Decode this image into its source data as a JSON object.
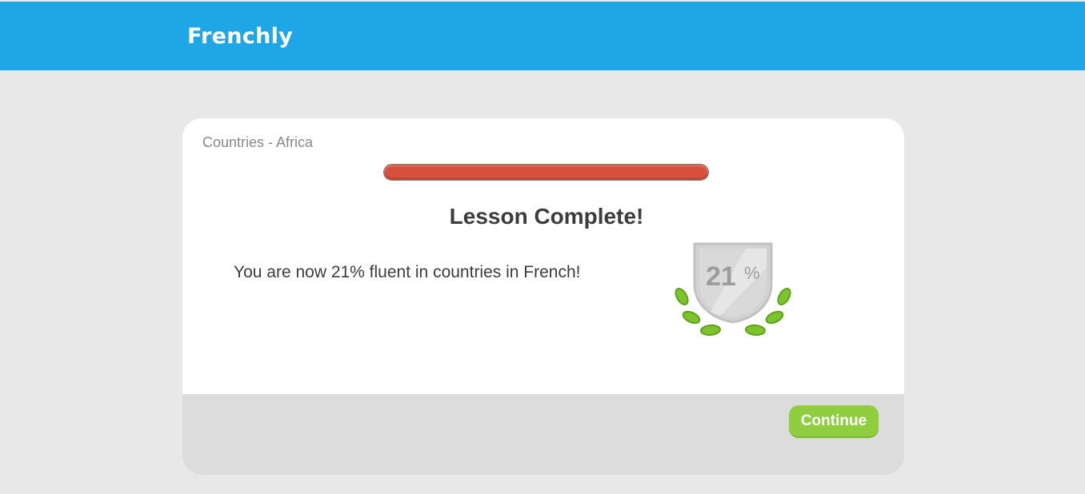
{
  "header": {
    "brand": "Frenchly"
  },
  "lesson": {
    "name": "Countries - Africa",
    "progress_fraction": 1.0,
    "headline": "Lesson Complete!",
    "message": "You are now 21% fluent in countries in French!"
  },
  "badge": {
    "value": "21",
    "unit": "%",
    "icon": "laurel-shield-icon"
  },
  "footer": {
    "continue_label": "Continue"
  },
  "colors": {
    "header": "#1fa6e6",
    "progress": "#d9503d",
    "button": "#8fcf3f",
    "laurel": "#7dc32b"
  }
}
